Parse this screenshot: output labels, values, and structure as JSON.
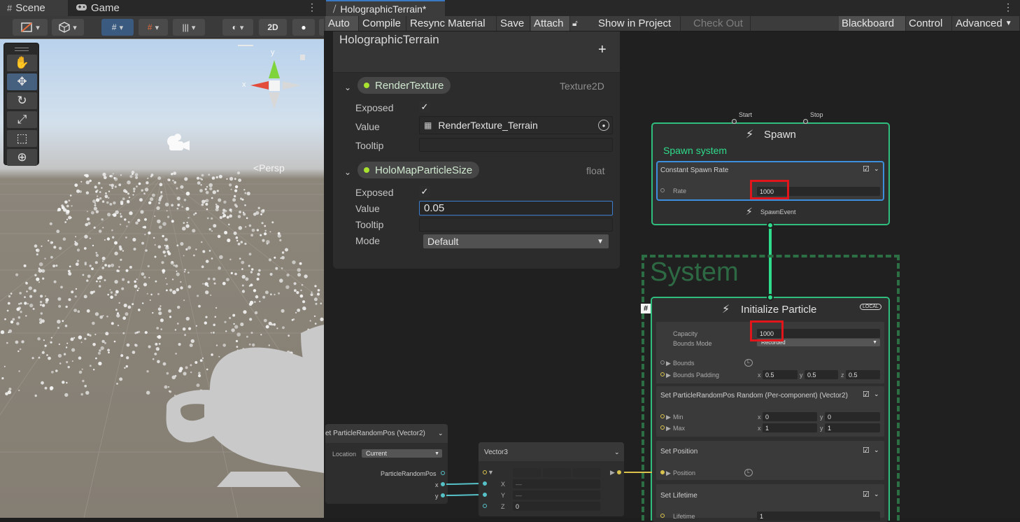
{
  "scene": {
    "tabs": [
      {
        "label": "Scene",
        "icon": "grid-icon"
      },
      {
        "label": "Game",
        "icon": "gamepad-icon"
      }
    ],
    "toolbar": {
      "view_2d": "2D"
    },
    "persp_label": "<Persp",
    "gizmo": {
      "x": "x",
      "y": "y"
    }
  },
  "vfx": {
    "tab_title": "HolographicTerrain*",
    "toolbar": {
      "auto": "Auto",
      "compile": "Compile",
      "resync": "Resync Material",
      "save": "Save",
      "attach": "Attach",
      "show_in_project": "Show in Project",
      "check_out": "Check Out",
      "blackboard": "Blackboard",
      "control": "Control",
      "advanced": "Advanced"
    }
  },
  "blackboard": {
    "title": "HolographicTerrain",
    "add": "+",
    "properties": [
      {
        "name": "RenderTexture",
        "type": "Texture2D",
        "exposed_label": "Exposed",
        "value_label": "Value",
        "value": "RenderTexture_Terrain",
        "tooltip_label": "Tooltip"
      },
      {
        "name": "HoloMapParticleSize",
        "type": "float",
        "exposed_label": "Exposed",
        "value_label": "Value",
        "value": "0.05",
        "tooltip_label": "Tooltip",
        "mode_label": "Mode",
        "mode_value": "Default"
      }
    ]
  },
  "spawn": {
    "start": "Start",
    "stop": "Stop",
    "title": "Spawn",
    "system_label": "Spawn system",
    "block_title": "Constant Spawn Rate",
    "rate_label": "Rate",
    "rate_value": "1000",
    "event_label": "SpawnEvent"
  },
  "system_label": "System",
  "init": {
    "hash": "#",
    "title": "Initialize Particle",
    "local_badge": "LOCAL",
    "capacity_label": "Capacity",
    "capacity_value": "1000",
    "bounds_mode_label": "Bounds Mode",
    "bounds_mode_value": "Recorded",
    "bounds_label": "Bounds",
    "bounds_padding_label": "Bounds Padding",
    "padding": {
      "x": "0.5",
      "y": "0.5",
      "z": "0.5"
    },
    "set_random_title": "Set ParticleRandomPos Random (Per-component) (Vector2)",
    "min_label": "Min",
    "max_label": "Max",
    "min": {
      "x": "0",
      "y": "0"
    },
    "max": {
      "x": "1",
      "y": "1"
    },
    "set_position_title": "Set Position",
    "position_label": "Position",
    "set_lifetime_title": "Set Lifetime",
    "lifetime_label": "Lifetime",
    "lifetime_value": "1"
  },
  "get_node": {
    "title": "et ParticleRandomPos (Vector2)",
    "location_label": "Location",
    "location_value": "Current",
    "output_label": "ParticleRandomPos",
    "x_label": "x",
    "y_label": "y"
  },
  "vector3_node": {
    "title": "Vector3",
    "x_label": "X",
    "y_label": "Y",
    "z_label": "Z",
    "x_value": "—",
    "y_value": "—",
    "z_value": "0"
  },
  "colors": {
    "spawn_context": "#2fbe7e",
    "highlight": "#e0161b",
    "selected_block": "#3b8fdc",
    "focus_field": "#3b7ed1",
    "exposed_dot": "#a8e22f"
  }
}
